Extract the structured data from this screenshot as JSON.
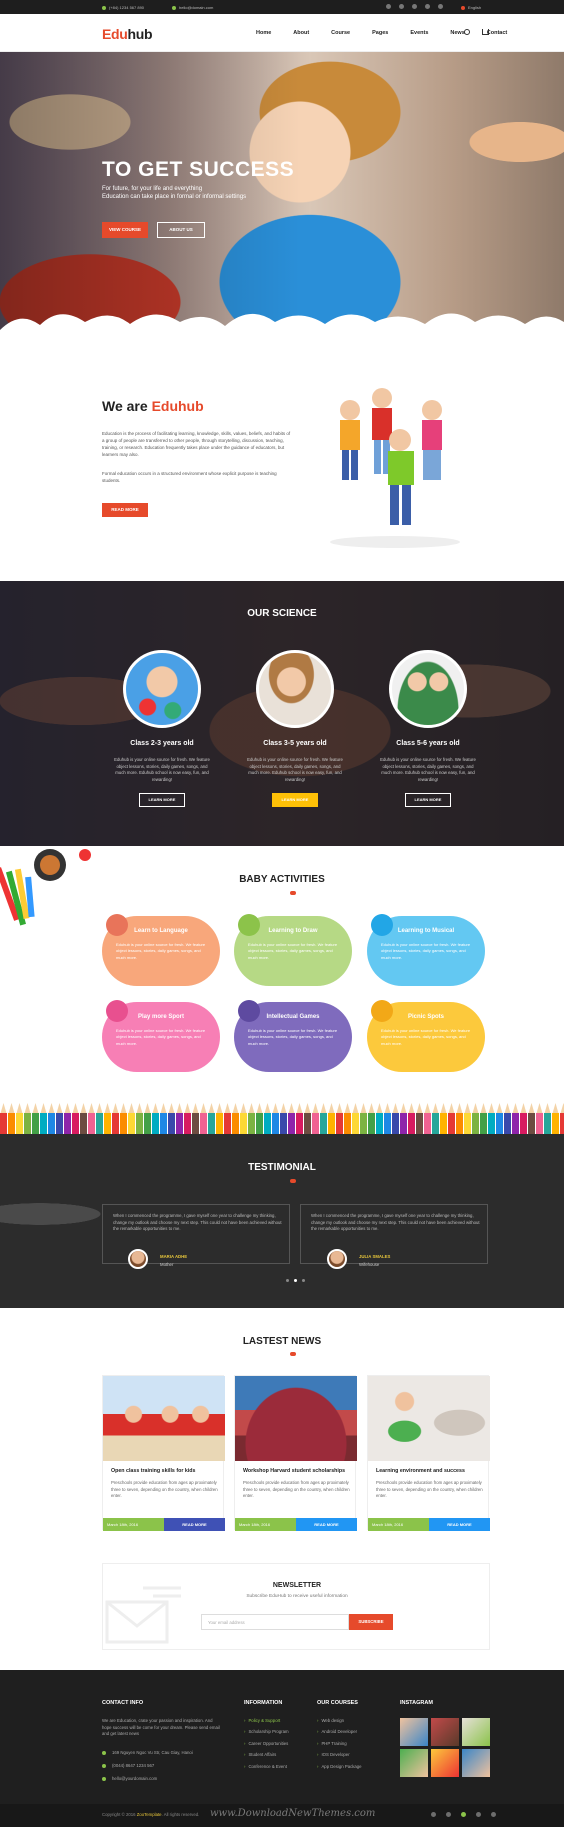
{
  "topbar": {
    "phone": "(+84) 1234 567 890",
    "email": "hello@domain.com",
    "language": "English",
    "social_icons": [
      "facebook-icon",
      "twitter-icon",
      "google-plus-icon",
      "instagram-icon",
      "pinterest-icon"
    ]
  },
  "header": {
    "logo_accent": "Edu",
    "logo_rest": "hub",
    "nav": [
      "Home",
      "About",
      "Course",
      "Pages",
      "Events",
      "News",
      "Contact"
    ]
  },
  "hero": {
    "title": "TO GET SUCCESS",
    "subtitle_line1": "For future, for your life and everything",
    "subtitle_line2": "Education can take place in formal or informal settings",
    "btn_primary": "VIEW COURSE",
    "btn_secondary": "ABOUT US"
  },
  "about": {
    "title_prefix": "We are",
    "title_brand": "Eduhub",
    "paragraph1": "Education is the process of facilitating learning, knowledge, skills, values, beliefs, and habits of a group of people are transferred to other people, through storytelling, discussion, teaching, training, or research. Education frequently takes place under the guidance of educators, but learners may also.",
    "paragraph2": "Formal education occurs in a structured environment whose explicit purpose is teaching students.",
    "button": "READ MORE"
  },
  "science": {
    "title": "OUR SCIENCE",
    "classes": [
      {
        "name": "Class 2-3 years old",
        "text": "Eduhub is your online source for fresh. We feature object lessons, stories, daily games, songs, and much more. Eduhub school is now easy, fun, and rewarding!",
        "button": "LEARN MORE"
      },
      {
        "name": "Class 3-5 years old",
        "text": "Eduhub is your online source for fresh. We feature object lessons, stories, daily games, songs, and much more. Eduhub school is now easy, fun, and rewarding!",
        "button": "LEARN MORE"
      },
      {
        "name": "Class 5-6 years old",
        "text": "Eduhub is your online source for fresh. We feature object lessons, stories, daily games, songs, and much more. Eduhub school is now easy, fun, and rewarding!",
        "button": "LEARN MORE"
      }
    ]
  },
  "activities": {
    "title": "BABY ACTIVITIES",
    "items": [
      {
        "name": "Learn to Language",
        "text": "Eduhub is your online source for fresh. We feature object lessons, stories, daily games, songs, and much more.",
        "color": "#f8a77b",
        "icon": "book-icon"
      },
      {
        "name": "Learning to Draw",
        "text": "Eduhub is your online source for fresh. We feature object lessons, stories, daily games, songs, and much more.",
        "color": "#b6d985",
        "icon": "brush-icon"
      },
      {
        "name": "Learning to Musical",
        "text": "Eduhub is your online source for fresh. We feature object lessons, stories, daily games, songs, and much more.",
        "color": "#63c8f2",
        "icon": "music-icon"
      },
      {
        "name": "Play more Sport",
        "text": "Eduhub is your online source for fresh. We feature object lessons, stories, daily games, songs, and much more.",
        "color": "#f77fb5",
        "icon": "ball-icon"
      },
      {
        "name": "Intellectual Games",
        "text": "Eduhub is your online source for fresh. We feature object lessons, stories, daily games, songs, and much more.",
        "color": "#7f6bbd",
        "icon": "puzzle-icon"
      },
      {
        "name": "Picnic Spots",
        "text": "Eduhub is your online source for fresh. We feature object lessons, stories, daily games, songs, and much more.",
        "color": "#fcc93c",
        "icon": "basket-icon"
      }
    ]
  },
  "testimonial": {
    "title": "TESTIMONIAL",
    "items": [
      {
        "text": "When I commenced the programme, I gave myself one year to challenge my thinking, change my outlook and choose my next step. This could not have been achieved without the remarkable opportunities to me.",
        "name": "MARIA ADHE",
        "role": "Mother"
      },
      {
        "text": "When I commenced the programme, I gave myself one year to challenge my thinking, change my outlook and choose my next step. This could not have been achieved without the remarkable opportunities to me.",
        "name": "JULIA SMALES",
        "role": "Wifehouse"
      }
    ]
  },
  "news": {
    "title": "LASTEST NEWS",
    "items": [
      {
        "title": "Open class training skills for kids",
        "text": "Preschools provide education from ages ap proximately three to seven, depending on the country, when children enter.",
        "date": "March 18th, 2016",
        "more": "READ MORE",
        "date_color": "#8bc34a",
        "more_color": "#3f51b5"
      },
      {
        "title": "Workshop Harvard student scholarships",
        "text": "Preschools provide education from ages ap proximately three to seven, depending on the country, when children enter.",
        "date": "March 18th, 2016",
        "more": "READ MORE",
        "date_color": "#8bc34a",
        "more_color": "#2196f3"
      },
      {
        "title": "Learning environment and success",
        "text": "Preschools provide education from ages ap proximately three to seven, depending on the country, when children enter.",
        "date": "March 18th, 2016",
        "more": "READ MORE",
        "date_color": "#8bc34a",
        "more_color": "#2196f3"
      }
    ]
  },
  "newsletter": {
    "title": "NEWSLETTER",
    "subtitle": "Subscribe EduHub to receive useful information",
    "placeholder": "Your email address",
    "button": "SUBSCRIBE"
  },
  "footer": {
    "contact_title": "CONTACT INFO",
    "contact_text": "We are Education, crate your passion and inspiration. And hope success will be come for your dream. Please send email and get latest news",
    "address": "169 Nguyen Ngoc Vu Str, Cau Giay, Hanoi",
    "phone": "(0044) 8647 1234 567",
    "mail": "hello@yourdomain.com",
    "info_title": "INFORMATION",
    "info_items": [
      "Policy & Support",
      "Scholarship Program",
      "Career Opportunities",
      "Student Affairs",
      "Conference & Event"
    ],
    "courses_title": "OUR COURSES",
    "courses_items": [
      "Web design",
      "Android Developer",
      "PHP Training",
      "IOS Developer",
      "App Design Package"
    ],
    "instagram_title": "INSTAGRAM",
    "copyright_prefix": "Copyright © 2016",
    "copyright_brand": "ZooTemplate",
    "copyright_suffix": ". All rights reserved."
  },
  "watermark": "www.DownloadNewThemes.com",
  "colors": {
    "accent": "#e64a2b",
    "dark": "#1f1f1f",
    "green": "#8bc34a",
    "yellow": "#ffc107"
  }
}
